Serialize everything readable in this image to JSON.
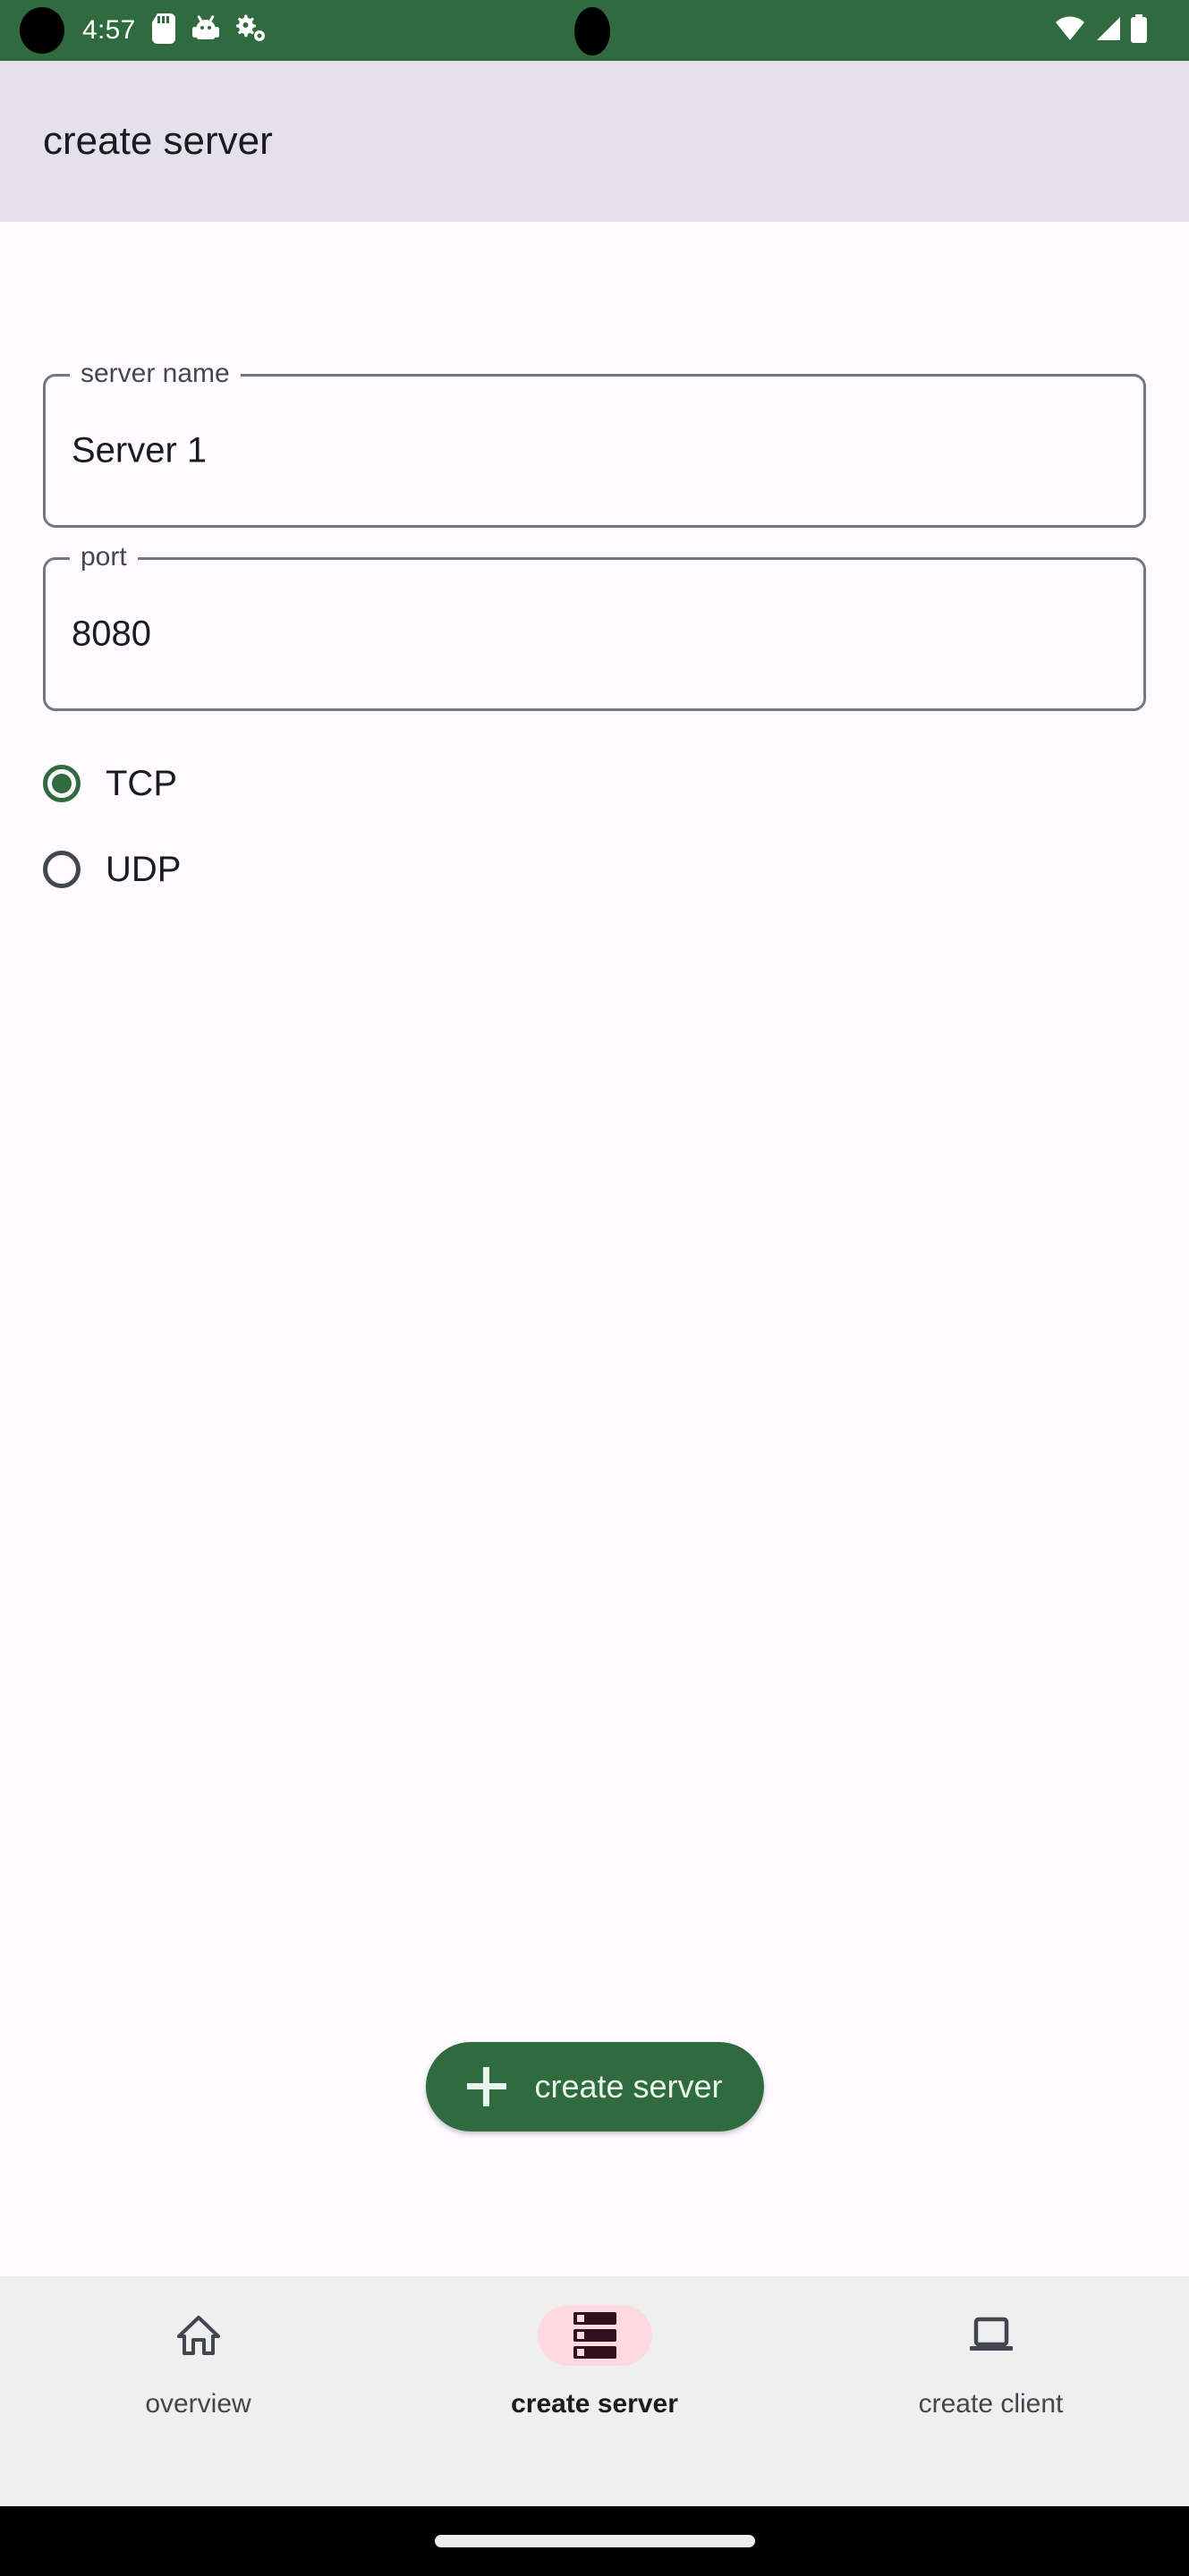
{
  "status_bar": {
    "time": "4:57",
    "background_color": "#2F6B3F",
    "icons": [
      "sd-card-icon",
      "android-bug-icon",
      "settings-gear-icon"
    ],
    "right_icons": [
      "wifi-icon",
      "cellular-signal-icon",
      "battery-icon"
    ]
  },
  "app_bar": {
    "title": "create server",
    "background_color": "#E4E1EC"
  },
  "form": {
    "fields": [
      {
        "label": "server name",
        "value": "Server 1",
        "placeholder": "server name"
      },
      {
        "label": "port",
        "value": "8080",
        "placeholder": "port"
      }
    ],
    "protocol": {
      "selected": "TCP",
      "options": [
        {
          "label": "TCP",
          "checked": true
        },
        {
          "label": "UDP",
          "checked": false
        }
      ]
    }
  },
  "fab": {
    "label": "create server",
    "icon": "plus-icon",
    "background_color": "#2F6B3F",
    "text_color": "#E9F5EC"
  },
  "bottom_nav": {
    "active_index": 1,
    "active_pill_color": "#FFD9E2",
    "items": [
      {
        "label": "overview",
        "icon": "home-icon",
        "active": false
      },
      {
        "label": "create server",
        "icon": "server-icon",
        "active": true
      },
      {
        "label": "create client",
        "icon": "laptop-icon",
        "active": false
      }
    ]
  }
}
